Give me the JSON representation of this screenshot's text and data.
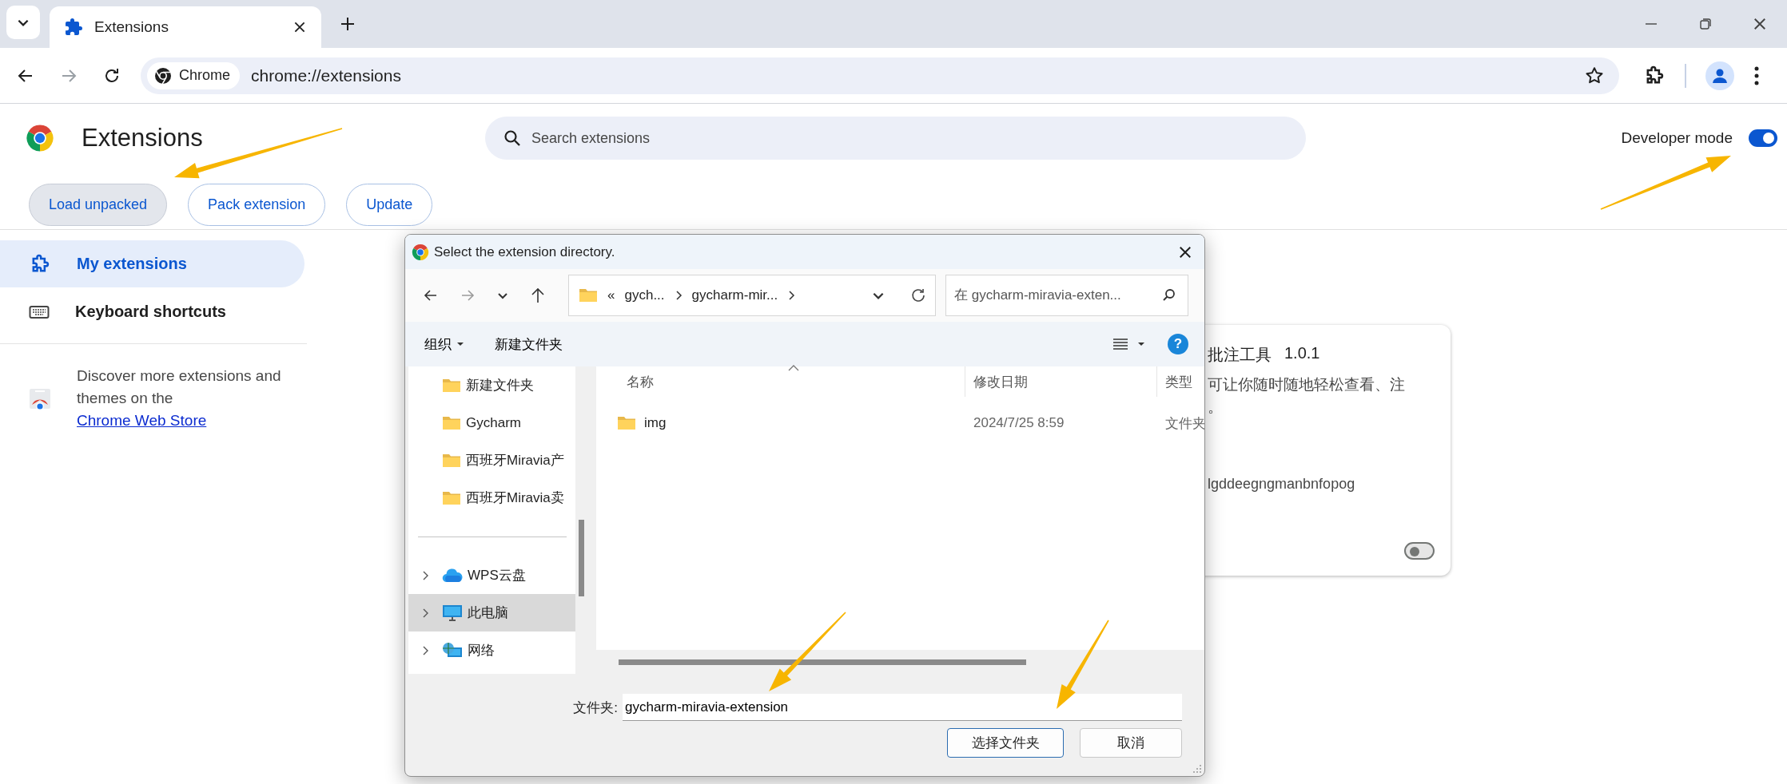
{
  "browser": {
    "tabs": [
      {
        "title": "Extensions",
        "selected": true
      }
    ],
    "address": {
      "chip": "Chrome",
      "url": "chrome://extensions"
    }
  },
  "header": {
    "title": "Extensions",
    "search": {
      "placeholder": "Search extensions"
    },
    "developer_mode": {
      "label": "Developer mode",
      "on": true
    }
  },
  "actions": [
    {
      "label": "Load unpacked",
      "pressed": true
    },
    {
      "label": "Pack extension",
      "pressed": false
    },
    {
      "label": "Update",
      "pressed": false
    }
  ],
  "sidebar": {
    "items": [
      {
        "label": "My extensions",
        "selected": true
      },
      {
        "label": "Keyboard shortcuts",
        "selected": false
      }
    ],
    "discover": {
      "text": "Discover more extensions and themes on the ",
      "link": "Chrome Web Store"
    }
  },
  "extension_card": {
    "name": "批注工具",
    "version": "1.0.1",
    "description_lines": [
      "可让你随时随地轻松查看、注",
      "。"
    ],
    "id": "lgddeegngmanbnfopog",
    "enabled": false
  },
  "dialog": {
    "title": "Select the extension directory.",
    "breadcrumb": [
      "«",
      "gych...",
      "gycharm-mir..."
    ],
    "search": {
      "placeholder": "在 gycharm-miravia-exten..."
    },
    "commands": {
      "organize": "组织",
      "new_folder": "新建文件夹",
      "help": "?"
    },
    "nav_pane": [
      {
        "label": "新建文件夹",
        "kind": "folder",
        "expandable": false,
        "selected": false
      },
      {
        "label": "Gycharm",
        "kind": "folder",
        "expandable": false,
        "selected": false
      },
      {
        "label": "西班牙Miravia产",
        "kind": "folder",
        "expandable": false,
        "selected": false
      },
      {
        "label": "西班牙Miravia卖",
        "kind": "folder",
        "expandable": false,
        "selected": false
      },
      {
        "kind": "separator"
      },
      {
        "label": "WPS云盘",
        "kind": "cloud",
        "expandable": true,
        "selected": false
      },
      {
        "label": "此电脑",
        "kind": "computer",
        "expandable": true,
        "selected": true
      },
      {
        "label": "网络",
        "kind": "network",
        "expandable": true,
        "selected": false
      }
    ],
    "columns": [
      "名称",
      "修改日期",
      "类型"
    ],
    "rows": [
      {
        "name": "img",
        "modified": "2024/7/25 8:59",
        "type": "文件夹"
      }
    ],
    "folder_label": "文件夹:",
    "folder_value": "gycharm-miravia-extension",
    "buttons": [
      {
        "label": "选择文件夹",
        "default": true
      },
      {
        "label": "取消",
        "default": false
      }
    ]
  }
}
